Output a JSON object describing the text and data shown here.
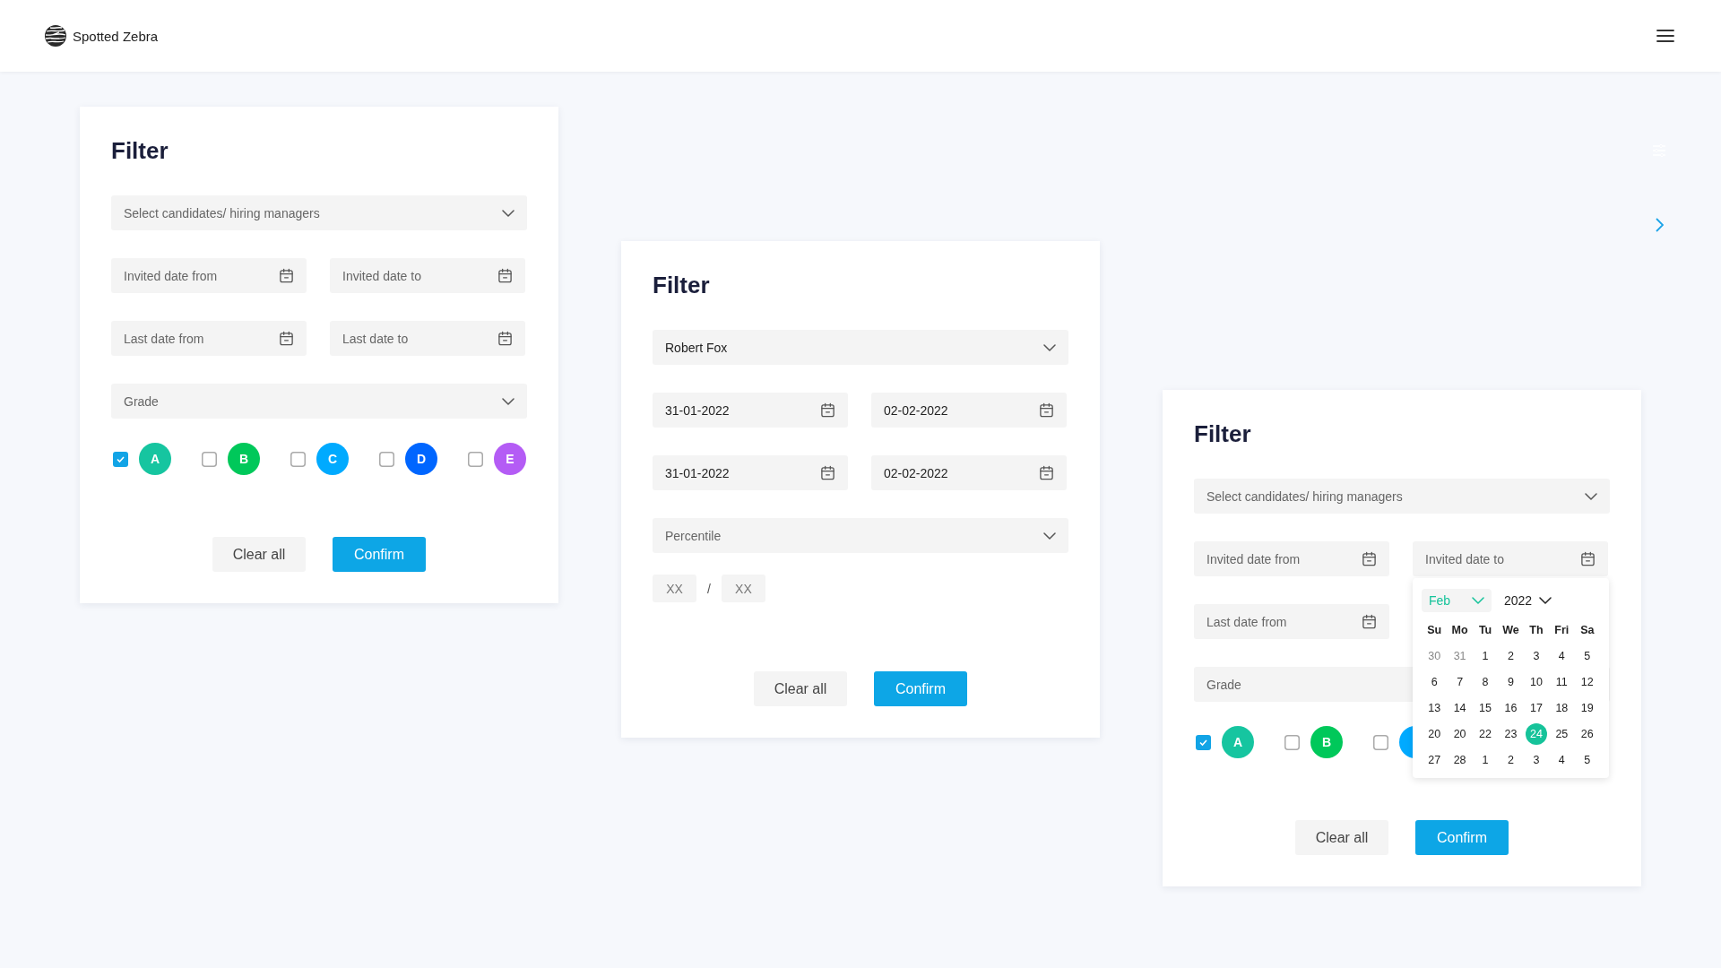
{
  "header": {
    "brand": "Spotted Zebra"
  },
  "cards": [
    {
      "title": "Filter",
      "fields": [
        {
          "kind": "dropdown",
          "placeholder": "Select candidates/ hiring managers"
        },
        {
          "kind": "date_pair",
          "dates": [
            {
              "placeholder": "Invited date from"
            },
            {
              "placeholder": "Invited date to"
            }
          ]
        },
        {
          "kind": "date_pair",
          "dates": [
            {
              "placeholder": "Last date from"
            },
            {
              "placeholder": "Last date to"
            }
          ]
        },
        {
          "kind": "dropdown",
          "placeholder": "Grade"
        },
        {
          "kind": "grades",
          "items": [
            {
              "letter": "A",
              "checked": true,
              "color": "#16c5a0"
            },
            {
              "letter": "B",
              "checked": false,
              "color": "#00c85a"
            },
            {
              "letter": "C",
              "checked": false,
              "color": "#00aaff"
            },
            {
              "letter": "D",
              "checked": false,
              "color": "#0066ff"
            },
            {
              "letter": "E",
              "checked": false,
              "color": "#b45cf5"
            }
          ]
        }
      ],
      "buttons": [
        {
          "label": "Clear all",
          "kind": "secondary"
        },
        {
          "label": "Confirm",
          "kind": "primary"
        }
      ]
    },
    {
      "title": "Filter",
      "fields": [
        {
          "kind": "dropdown",
          "value": "Robert Fox"
        },
        {
          "kind": "date_pair",
          "dates": [
            {
              "value": "31-01-2022"
            },
            {
              "value": "02-02-2022"
            }
          ]
        },
        {
          "kind": "date_pair",
          "dates": [
            {
              "value": "31-01-2022"
            },
            {
              "value": "02-02-2022"
            }
          ]
        },
        {
          "kind": "dropdown",
          "placeholder": "Percentile"
        },
        {
          "kind": "range",
          "from": {
            "placeholder": "XX"
          },
          "separator": "/",
          "to": {
            "placeholder": "XX"
          }
        }
      ],
      "buttons": [
        {
          "label": "Clear all",
          "kind": "secondary"
        },
        {
          "label": "Confirm",
          "kind": "primary"
        }
      ]
    },
    {
      "title": "Filter",
      "fields": [
        {
          "kind": "dropdown",
          "placeholder": "Select candidates/ hiring managers"
        },
        {
          "kind": "date_pair",
          "dates": [
            {
              "placeholder": "Invited date from"
            },
            {
              "placeholder": "Invited date to",
              "calendar": {
                "month": "Feb",
                "year": "2022",
                "weekdays": [
                  "Su",
                  "Mo",
                  "Tu",
                  "We",
                  "Th",
                  "Fri",
                  "Sa"
                ],
                "weeks": [
                  [
                    {
                      "day": "30",
                      "muted": true,
                      "selected": false
                    },
                    {
                      "day": "31",
                      "muted": true,
                      "selected": false
                    },
                    {
                      "day": "1",
                      "muted": false,
                      "selected": false
                    },
                    {
                      "day": "2",
                      "muted": false,
                      "selected": false
                    },
                    {
                      "day": "3",
                      "muted": false,
                      "selected": false
                    },
                    {
                      "day": "4",
                      "muted": false,
                      "selected": false
                    },
                    {
                      "day": "5",
                      "muted": false,
                      "selected": false
                    }
                  ],
                  [
                    {
                      "day": "6",
                      "muted": false,
                      "selected": false
                    },
                    {
                      "day": "7",
                      "muted": false,
                      "selected": false
                    },
                    {
                      "day": "8",
                      "muted": false,
                      "selected": false
                    },
                    {
                      "day": "9",
                      "muted": false,
                      "selected": false
                    },
                    {
                      "day": "10",
                      "muted": false,
                      "selected": false
                    },
                    {
                      "day": "11",
                      "muted": false,
                      "selected": false
                    },
                    {
                      "day": "12",
                      "muted": false,
                      "selected": false
                    }
                  ],
                  [
                    {
                      "day": "13",
                      "muted": false,
                      "selected": false
                    },
                    {
                      "day": "14",
                      "muted": false,
                      "selected": false
                    },
                    {
                      "day": "15",
                      "muted": false,
                      "selected": false
                    },
                    {
                      "day": "16",
                      "muted": false,
                      "selected": false
                    },
                    {
                      "day": "17",
                      "muted": false,
                      "selected": false
                    },
                    {
                      "day": "18",
                      "muted": false,
                      "selected": false
                    },
                    {
                      "day": "19",
                      "muted": false,
                      "selected": false
                    }
                  ],
                  [
                    {
                      "day": "20",
                      "muted": false,
                      "selected": false
                    },
                    {
                      "day": "20",
                      "muted": false,
                      "selected": false
                    },
                    {
                      "day": "22",
                      "muted": false,
                      "selected": false
                    },
                    {
                      "day": "23",
                      "muted": false,
                      "selected": false
                    },
                    {
                      "day": "24",
                      "muted": false,
                      "selected": true
                    },
                    {
                      "day": "25",
                      "muted": false,
                      "selected": false
                    },
                    {
                      "day": "26",
                      "muted": false,
                      "selected": false
                    }
                  ],
                  [
                    {
                      "day": "27",
                      "muted": false,
                      "selected": false
                    },
                    {
                      "day": "28",
                      "muted": false,
                      "selected": false
                    },
                    {
                      "day": "1",
                      "muted": false,
                      "selected": false
                    },
                    {
                      "day": "2",
                      "muted": false,
                      "selected": false
                    },
                    {
                      "day": "3",
                      "muted": false,
                      "selected": false
                    },
                    {
                      "day": "4",
                      "muted": false,
                      "selected": false
                    },
                    {
                      "day": "5",
                      "muted": false,
                      "selected": false
                    }
                  ]
                ]
              }
            }
          ]
        },
        {
          "kind": "date_pair",
          "dates": [
            {
              "placeholder": "Last date from"
            }
          ]
        },
        {
          "kind": "dropdown",
          "placeholder": "Grade"
        },
        {
          "kind": "grades",
          "items": [
            {
              "letter": "A",
              "checked": true,
              "color": "#16c5a0"
            },
            {
              "letter": "B",
              "checked": false,
              "color": "#00c85a"
            },
            {
              "checked": false,
              "color": "#00aaff"
            }
          ]
        }
      ],
      "buttons": [
        {
          "label": "Clear all",
          "kind": "secondary"
        },
        {
          "label": "Confirm",
          "kind": "primary"
        }
      ]
    }
  ]
}
